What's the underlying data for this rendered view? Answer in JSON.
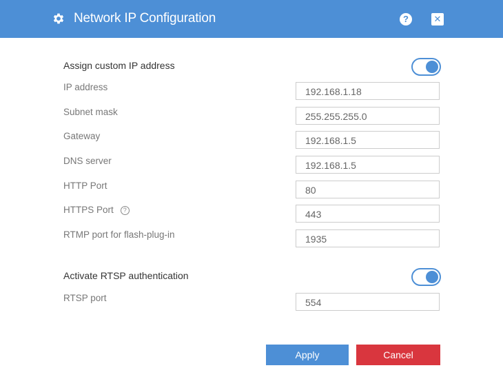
{
  "dialog": {
    "title": "Network IP Configuration",
    "icons": {
      "title": "gear-icon",
      "help": "help-icon",
      "close": "close-icon"
    },
    "help_glyph": "?",
    "close_glyph": "✕"
  },
  "custom_ip": {
    "label": "Assign custom IP address",
    "enabled": true
  },
  "fields": {
    "ip_address": {
      "label": "IP address",
      "value": "192.168.1.18"
    },
    "subnet_mask": {
      "label": "Subnet mask",
      "value": "255.255.255.0"
    },
    "gateway": {
      "label": "Gateway",
      "value": "192.168.1.5"
    },
    "dns_server": {
      "label": "DNS server",
      "value": "192.168.1.5"
    },
    "http_port": {
      "label": "HTTP Port",
      "value": "80"
    },
    "https_port": {
      "label": "HTTPS Port",
      "value": "443",
      "info_glyph": "?"
    },
    "rtmp_port": {
      "label": "RTMP port for flash-plug-in",
      "value": "1935"
    }
  },
  "rtsp": {
    "label": "Activate RTSP authentication",
    "enabled": true,
    "port_label": "RTSP port",
    "port_value": "554"
  },
  "buttons": {
    "apply": "Apply",
    "cancel": "Cancel"
  },
  "colors": {
    "accent": "#4d8fd6",
    "danger": "#d9363e"
  }
}
